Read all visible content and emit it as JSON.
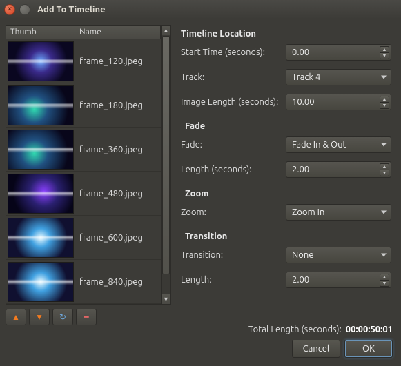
{
  "window": {
    "title": "Add To Timeline"
  },
  "list": {
    "headers": {
      "thumb": "Thumb",
      "name": "Name"
    },
    "rows": [
      {
        "name": "frame_120.jpeg"
      },
      {
        "name": "frame_180.jpeg"
      },
      {
        "name": "frame_360.jpeg"
      },
      {
        "name": "frame_480.jpeg"
      },
      {
        "name": "frame_600.jpeg"
      },
      {
        "name": "frame_840.jpeg"
      }
    ]
  },
  "sections": {
    "timeline_location": "Timeline Location",
    "fade": "Fade",
    "zoom": "Zoom",
    "transition": "Transition"
  },
  "fields": {
    "start_time": {
      "label": "Start Time (seconds):",
      "value": "0.00"
    },
    "track": {
      "label": "Track:",
      "value": "Track 4"
    },
    "image_length": {
      "label": "Image Length (seconds):",
      "value": "10.00"
    },
    "fade": {
      "label": "Fade:",
      "value": "Fade In & Out"
    },
    "fade_length": {
      "label": "Length (seconds):",
      "value": "2.00"
    },
    "zoom": {
      "label": "Zoom:",
      "value": "Zoom In"
    },
    "transition": {
      "label": "Transition:",
      "value": "None"
    },
    "transition_length": {
      "label": "Length:",
      "value": "2.00"
    }
  },
  "footer": {
    "total_label": "Total Length (seconds):",
    "total_value": "00:00:50:01",
    "cancel": "Cancel",
    "ok": "OK"
  }
}
